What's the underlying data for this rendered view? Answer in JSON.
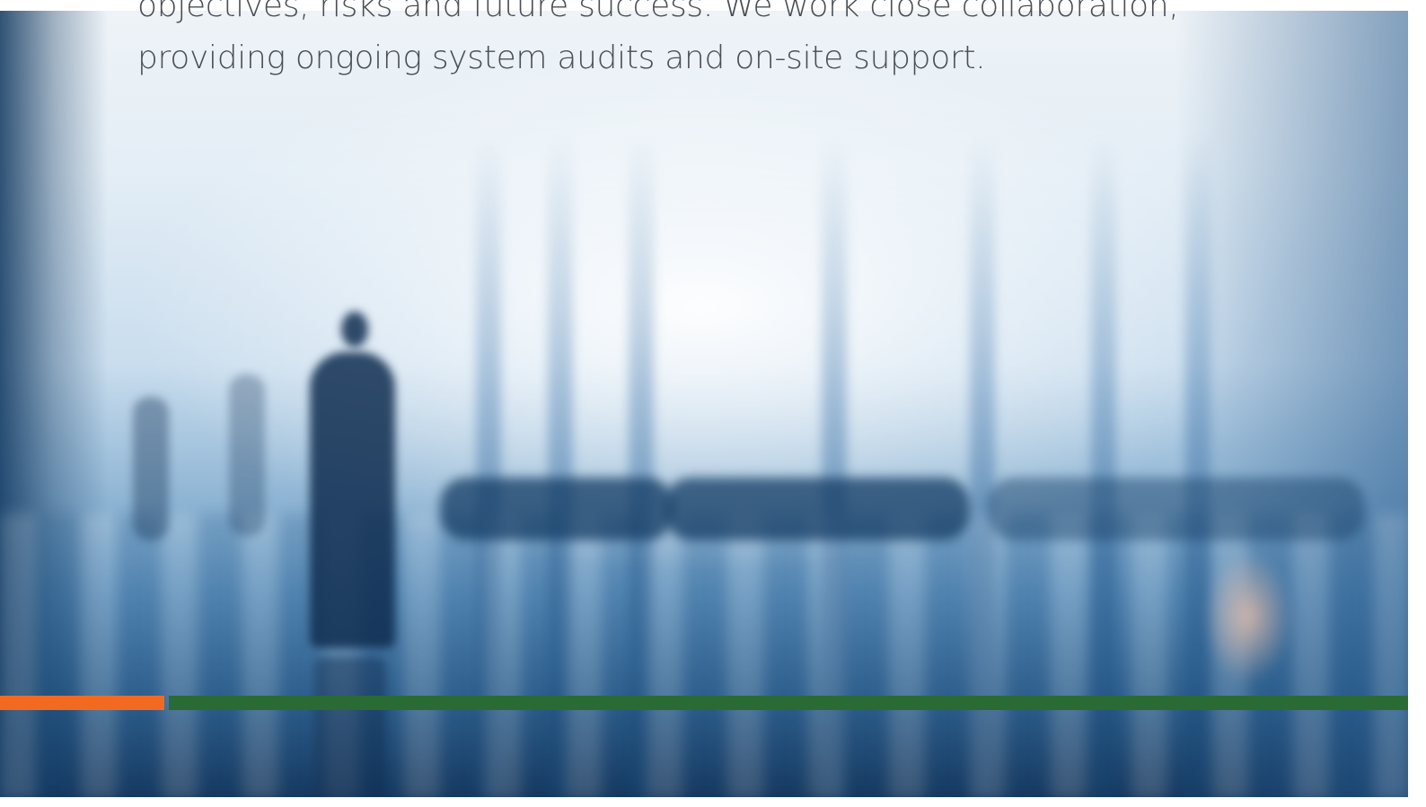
{
  "intro": {
    "text": "objectives, risks and future success. We work close collaboration, providing ongoing system audits and on-site support."
  },
  "hero": {
    "image_name": "blurred-office-lobby-with-walking-businessman"
  },
  "accent_bar": {
    "orange_color": "#f26a21",
    "green_color": "#2a6a35"
  }
}
